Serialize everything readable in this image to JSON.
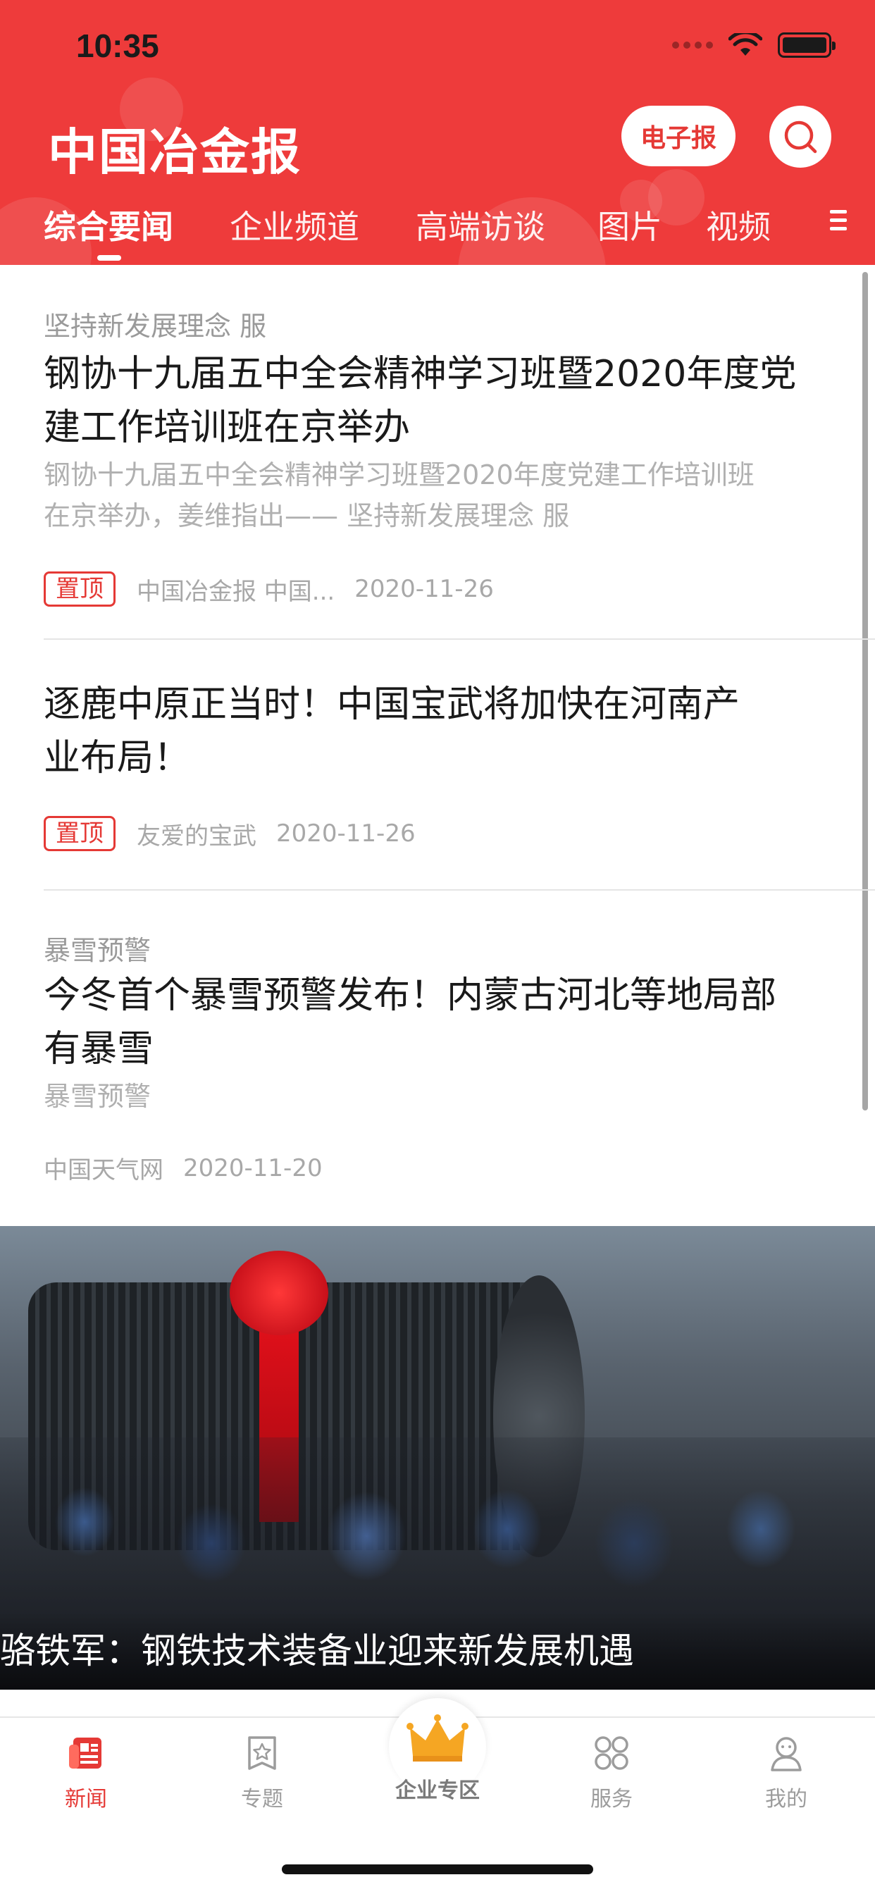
{
  "status_bar": {
    "time": "10:35"
  },
  "header": {
    "logo_text": "中国冶金报",
    "epaper_label": "电子报",
    "brand_color": "#ee3b3b"
  },
  "tabs": [
    {
      "label": "综合要闻",
      "active": true
    },
    {
      "label": "企业频道",
      "active": false
    },
    {
      "label": "高端访谈",
      "active": false
    },
    {
      "label": "图片",
      "active": false
    },
    {
      "label": "视频",
      "active": false
    }
  ],
  "articles": [
    {
      "tag": "坚持新发展理念 服",
      "title_line1": "钢协十九届五中全会精神学习班暨2020年度党",
      "title_line2": "建工作培训班在京举办",
      "summary_line1": "钢协十九届五中全会精神学习班暨2020年度党建工作培训班",
      "summary_line2": "在京举办，姜维指出——  坚持新发展理念 服",
      "badge": "置顶",
      "source": "中国冶金报 中国...",
      "date": "2020-11-26"
    },
    {
      "title_line1": "逐鹿中原正当时！中国宝武将加快在河南产",
      "title_line2": "业布局！",
      "badge": "置顶",
      "source": "友爱的宝武",
      "date": "2020-11-26"
    },
    {
      "tag": "暴雪预警",
      "title_line1": "今冬首个暴雪预警发布！内蒙古河北等地局部",
      "title_line2": "有暴雪",
      "summary_line1": "暴雪预警",
      "source": "中国天气网",
      "date": "2020-11-20"
    }
  ],
  "photo_banner": {
    "caption": "骆铁军：钢铁技术装备业迎来新发展机遇"
  },
  "bottom_nav": [
    {
      "label": "新闻",
      "icon": "newspaper-icon",
      "active": true
    },
    {
      "label": "专题",
      "icon": "star-badge-icon",
      "active": false
    },
    {
      "label": "企业专区",
      "icon": "crown-icon",
      "active": false
    },
    {
      "label": "服务",
      "icon": "grid-icon",
      "active": false
    },
    {
      "label": "我的",
      "icon": "user-icon",
      "active": false
    }
  ],
  "colors": {
    "accent": "#e53935",
    "muted_text": "#9a9a9a"
  }
}
